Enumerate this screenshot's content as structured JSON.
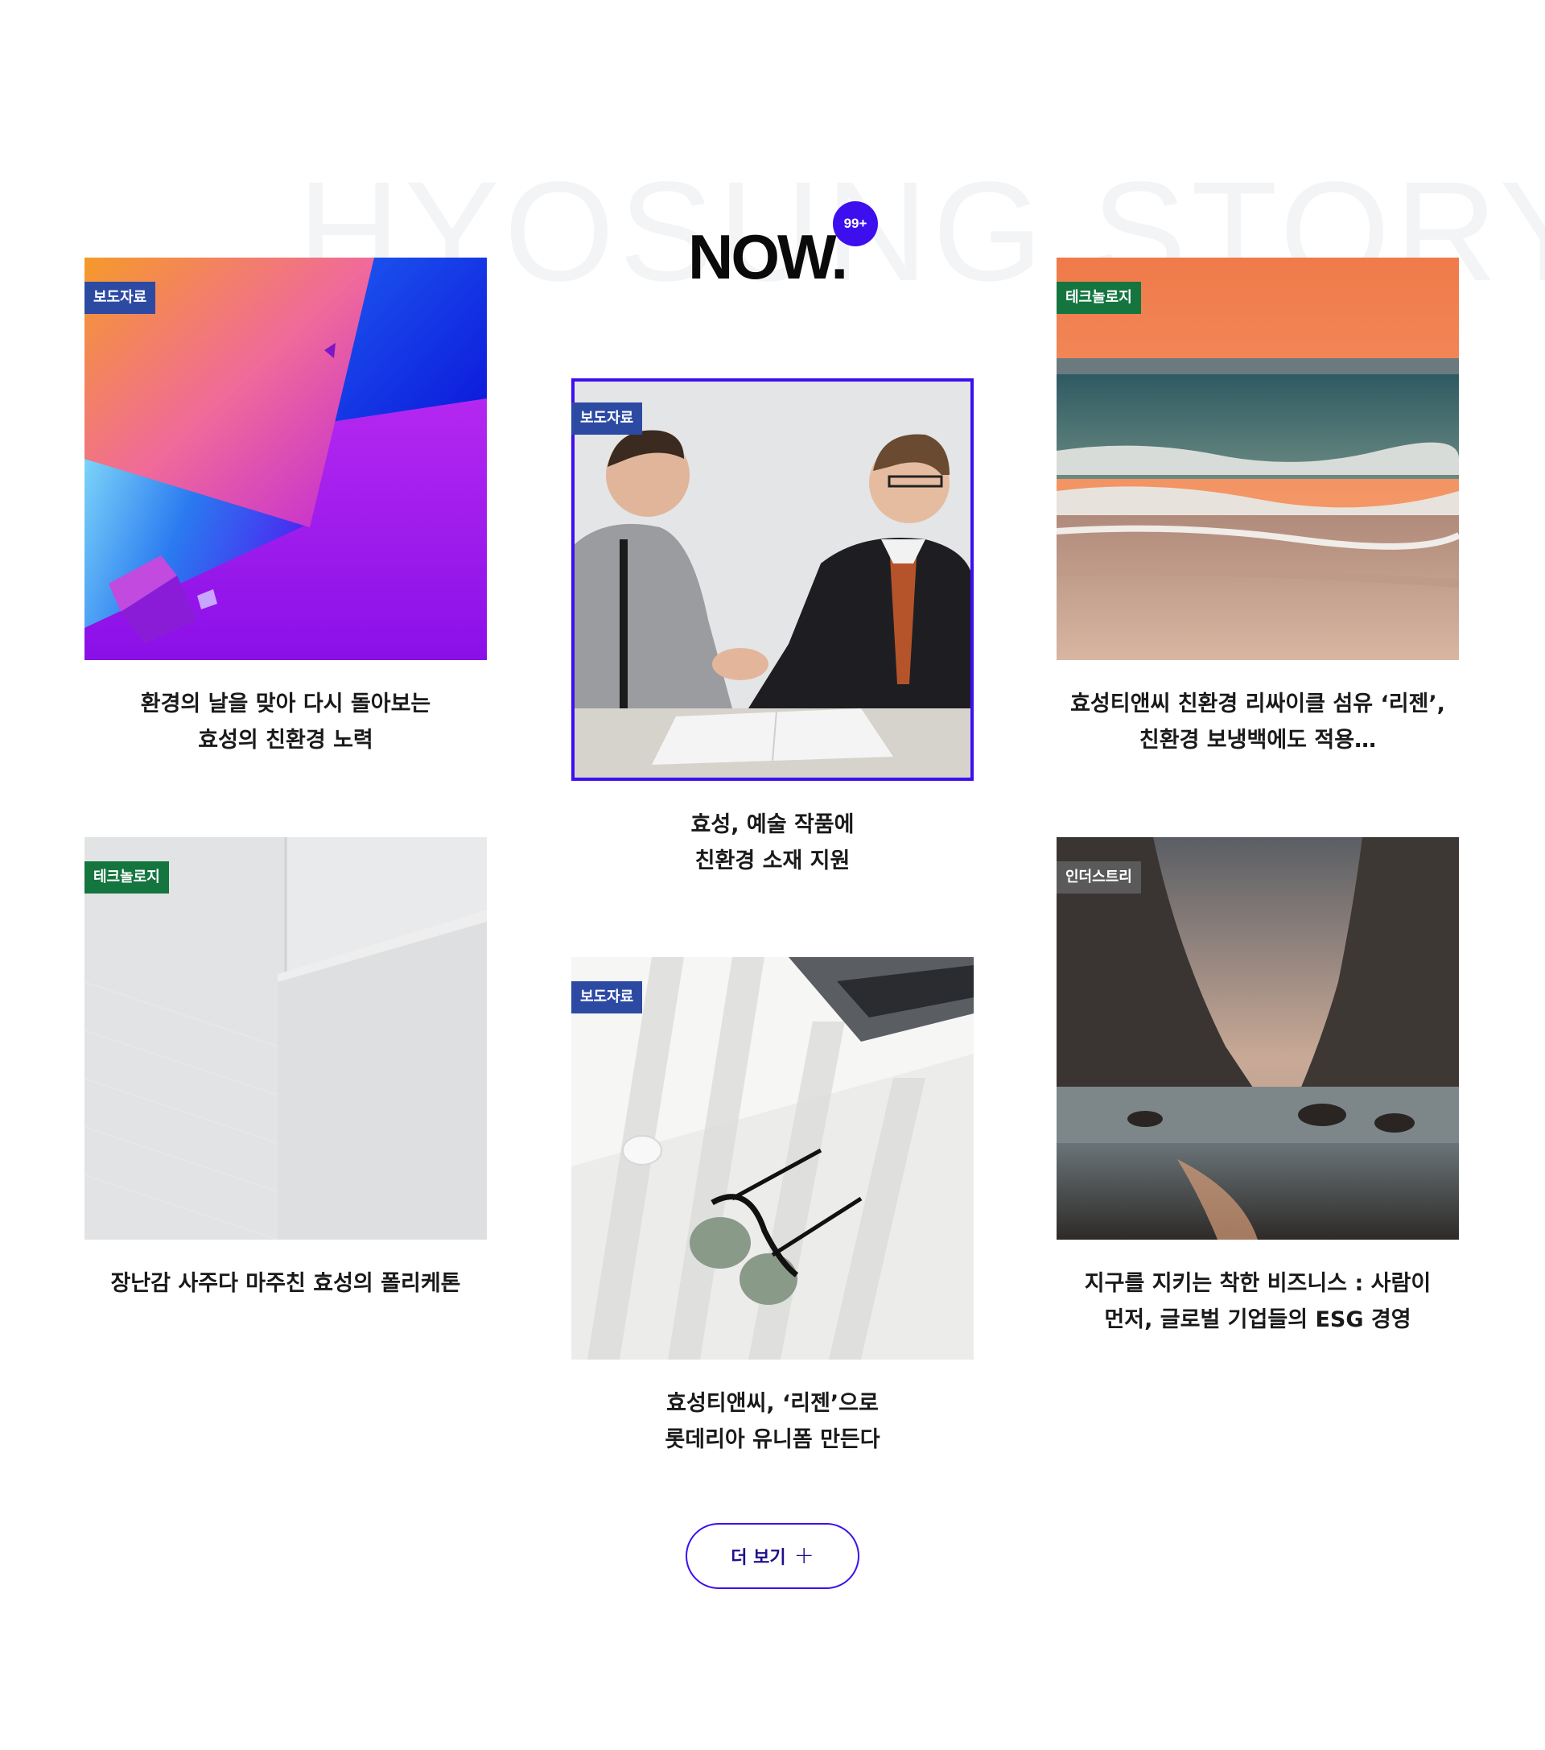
{
  "section": {
    "background_title": "HYOSUNG STORY",
    "heading": "NOW.",
    "badge": "99+"
  },
  "cards": [
    {
      "tag": "보도자료",
      "title": "환경의 날을 맞아 다시 돌아보는\n효성의 친환경 노력",
      "image": "abstract-gradient-cube-image"
    },
    {
      "tag": "보도자료",
      "title": "효성, 예술 작품에\n친환경 소재 지원",
      "image": "handshake-meeting-image"
    },
    {
      "tag": "테크놀로지",
      "title": "효성티앤씨 친환경 리싸이클 섬유 ‘리젠’,\n친환경 보냉백에도 적용…",
      "image": "sunset-ocean-waves-image"
    },
    {
      "tag": "테크놀로지",
      "title": "장난감 사주다 마주친 효성의 폴리케톤",
      "image": "white-textured-wall-image"
    },
    {
      "tag": "보도자료",
      "title": "효성티앤씨, ‘리젠’으로\n롯데리아 유니폼 만든다",
      "image": "sunglasses-desk-image"
    },
    {
      "tag": "인더스트리",
      "title": "지구를 지키는 착한 비즈니스 : 사람이\n먼저, 글로벌 기업들의 ESG 경영",
      "image": "rocky-beach-sunset-image"
    }
  ],
  "more_button": {
    "label": "더 보기",
    "icon": "plus-icon"
  },
  "colors": {
    "accent": "#3d0fee",
    "tag_blue": "#2d4aa3",
    "tag_green": "#14753f",
    "tag_gray": "#5a5a5a"
  }
}
